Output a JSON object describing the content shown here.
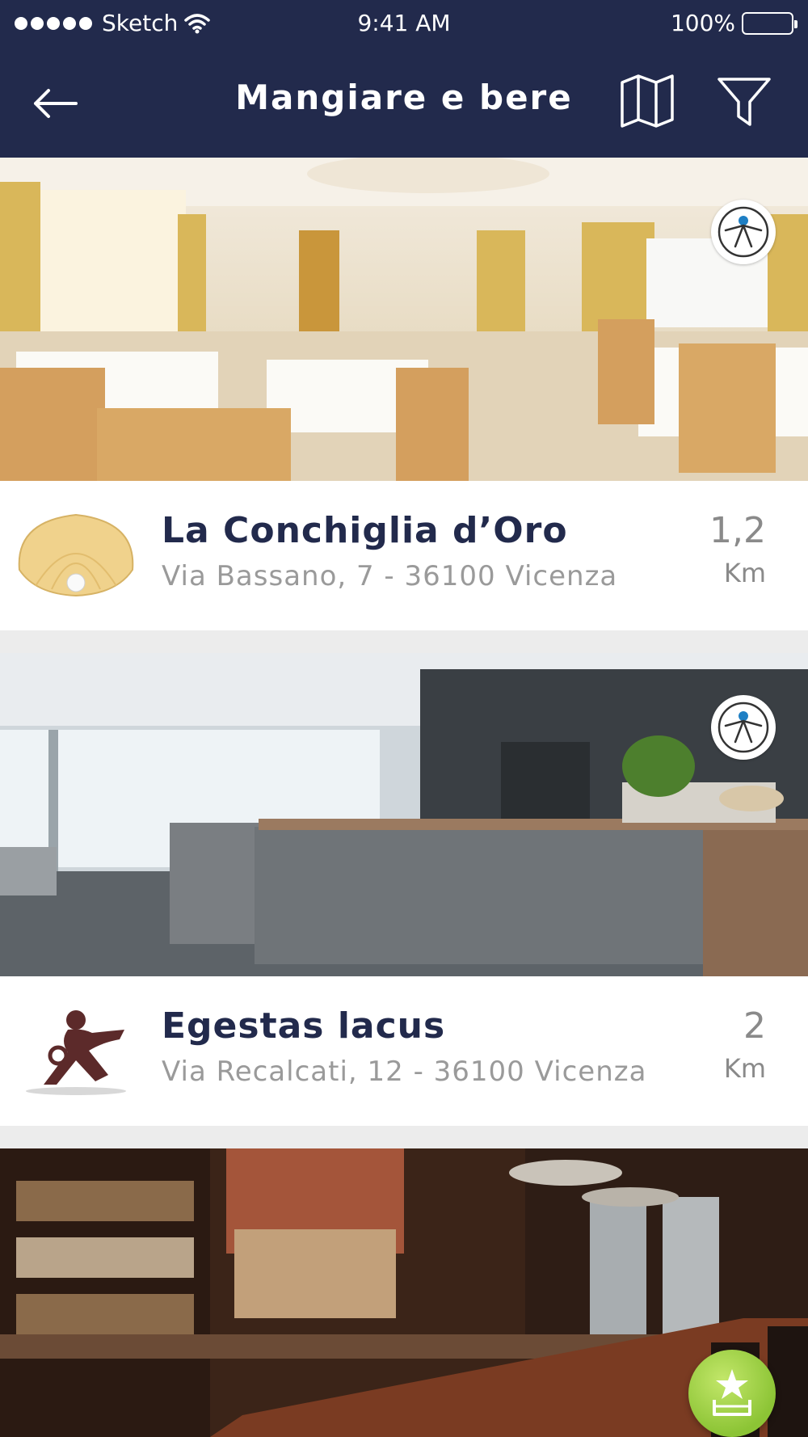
{
  "status_bar": {
    "carrier": "Sketch",
    "time": "9:41 AM",
    "battery": "100%"
  },
  "header": {
    "title": "Mangiare e bere",
    "back_icon": "arrow-left-icon",
    "map_icon": "map-icon",
    "filter_icon": "filter-icon"
  },
  "colors": {
    "header_bg": "#222a4c",
    "name_text": "#222a4c",
    "address_text": "#9a9a9a",
    "accent": "#8cc435",
    "accessibility_blue": "#1e7fc4"
  },
  "restaurants": [
    {
      "name": "La Conchiglia d’Oro",
      "address": "Via Bassano, 7 - 36100 Vicenza",
      "distance": "1,2",
      "unit": "Km",
      "logo_text": "La Conchiglia d’Oro",
      "accessible": true
    },
    {
      "name": "Egestas lacus",
      "address": "Via Recalcati, 12 - 36100 Vicenza",
      "distance": "2",
      "unit": "Km",
      "accessible": true
    },
    {
      "name": "",
      "address": "",
      "accessible": false
    }
  ],
  "fab_icon": "star-badge-icon"
}
